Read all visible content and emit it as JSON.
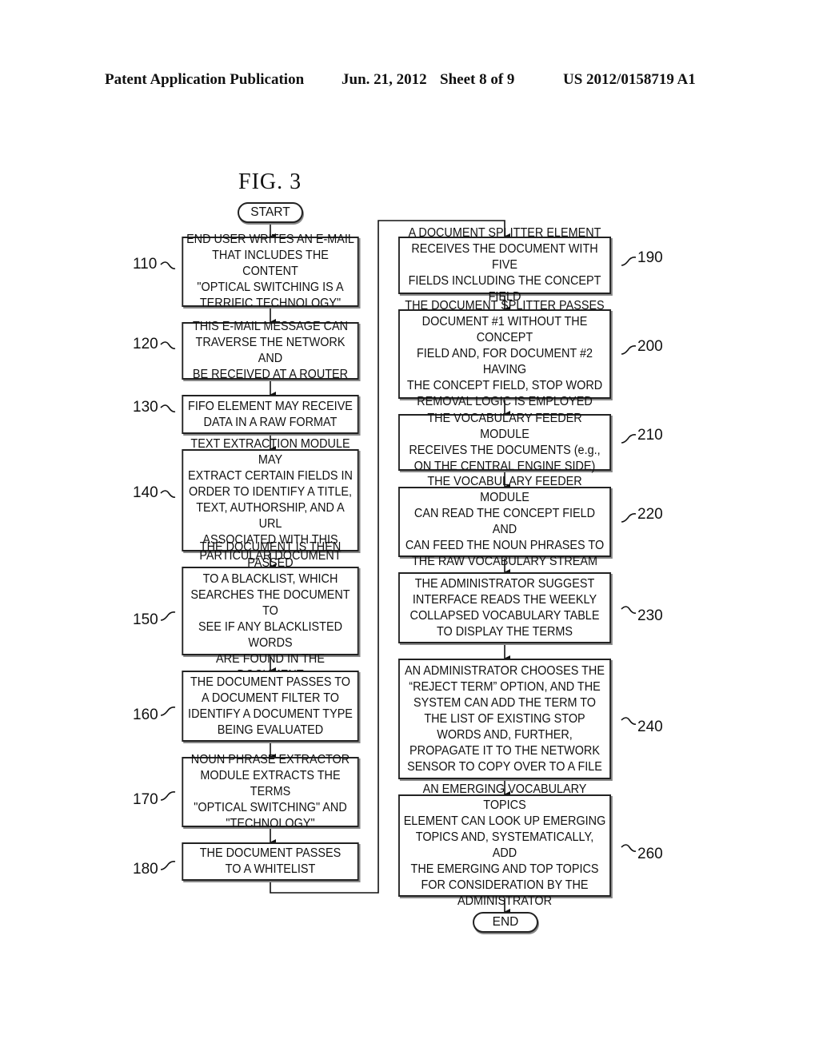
{
  "header": {
    "publication": "Patent Application Publication",
    "date": "Jun. 21, 2012",
    "sheet": "Sheet 8 of 9",
    "number": "US 2012/0158719 A1"
  },
  "figure": {
    "title": "FIG. 3"
  },
  "terminals": {
    "start": "START",
    "end": "END"
  },
  "left_column": [
    {
      "ref": "110",
      "text": "END USER WRITES AN E-MAIL\nTHAT INCLUDES THE CONTENT\n\"OPTICAL SWITCHING IS A\nTERRIFIC TECHNOLOGY\""
    },
    {
      "ref": "120",
      "text": "THIS E-MAIL MESSAGE CAN\nTRAVERSE THE NETWORK AND\nBE RECEIVED AT A ROUTER"
    },
    {
      "ref": "130",
      "text": "FIFO ELEMENT MAY RECEIVE\nDATA IN A RAW FORMAT"
    },
    {
      "ref": "140",
      "text": "TEXT EXTRACTION MODULE MAY\nEXTRACT CERTAIN FIELDS IN\nORDER TO IDENTIFY A TITLE,\nTEXT, AUTHORSHIP, AND A URL\nASSOCIATED WITH THIS\nPARTICULAR DOCUMENT"
    },
    {
      "ref": "150",
      "text": "THE DOCUMENT IS THEN PASSED\nTO A BLACKLIST, WHICH\nSEARCHES THE DOCUMENT TO\nSEE IF ANY BLACKLISTED WORDS\nARE FOUND IN THE DOCUMENT"
    },
    {
      "ref": "160",
      "text": "THE DOCUMENT PASSES TO\nA DOCUMENT FILTER TO\nIDENTIFY A DOCUMENT TYPE\nBEING EVALUATED"
    },
    {
      "ref": "170",
      "text": "NOUN PHRASE EXTRACTOR\nMODULE EXTRACTS THE TERMS\n\"OPTICAL SWITCHING\" AND\n\"TECHNOLOGY\""
    },
    {
      "ref": "180",
      "text": "THE DOCUMENT PASSES\nTO A WHITELIST"
    }
  ],
  "right_column": [
    {
      "ref": "190",
      "text": "A DOCUMENT SPLITTER ELEMENT\nRECEIVES THE DOCUMENT WITH FIVE\nFIELDS INCLUDING THE CONCEPT FIELD"
    },
    {
      "ref": "200",
      "text": "THE DOCUMENT SPLITTER PASSES\nDOCUMENT #1 WITHOUT THE CONCEPT\nFIELD AND, FOR DOCUMENT #2 HAVING\nTHE CONCEPT FIELD, STOP WORD\nREMOVAL LOGIC IS EMPLOYED"
    },
    {
      "ref": "210",
      "text": "THE VOCABULARY FEEDER MODULE\nRECEIVES THE DOCUMENTS (e.g.,\nON THE CENTRAL ENGINE SIDE)"
    },
    {
      "ref": "220",
      "text": "THE VOCABULARY FEEDER MODULE\nCAN READ THE CONCEPT FIELD AND\nCAN FEED THE NOUN PHRASES TO\nTHE RAW VOCABULARY STREAM"
    },
    {
      "ref": "230",
      "text": "THE ADMINISTRATOR SUGGEST\nINTERFACE READS THE WEEKLY\nCOLLAPSED VOCABULARY TABLE\nTO DISPLAY THE TERMS"
    },
    {
      "ref": "240",
      "text": "AN ADMINISTRATOR CHOOSES THE\n“REJECT TERM” OPTION, AND THE\nSYSTEM CAN ADD THE TERM TO\nTHE LIST OF EXISTING STOP\nWORDS AND, FURTHER,\nPROPAGATE IT TO THE NETWORK\nSENSOR TO COPY OVER TO A FILE"
    },
    {
      "ref": "260",
      "text": "AN EMERGING VOCABULARY TOPICS\nELEMENT CAN LOOK UP EMERGING\nTOPICS AND, SYSTEMATICALLY, ADD\nTHE EMERGING AND TOP TOPICS\nFOR CONSIDERATION BY THE\nADMINISTRATOR"
    }
  ]
}
